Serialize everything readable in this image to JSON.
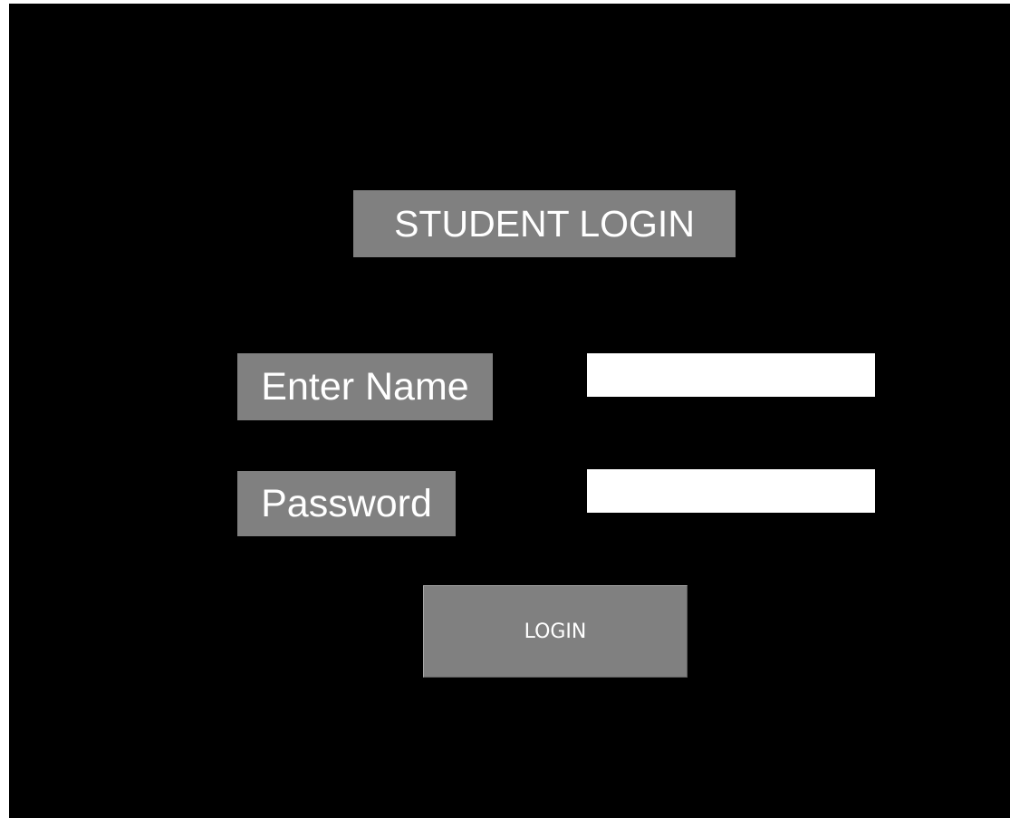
{
  "login_form": {
    "title": "STUDENT LOGIN",
    "name_label": "Enter Name",
    "name_value": "",
    "password_label": "Password",
    "password_value": "",
    "login_button_label": "LOGIN"
  },
  "colors": {
    "background": "#000000",
    "label_background": "#808080",
    "text": "#ffffff",
    "field_background": "#ffffff"
  }
}
